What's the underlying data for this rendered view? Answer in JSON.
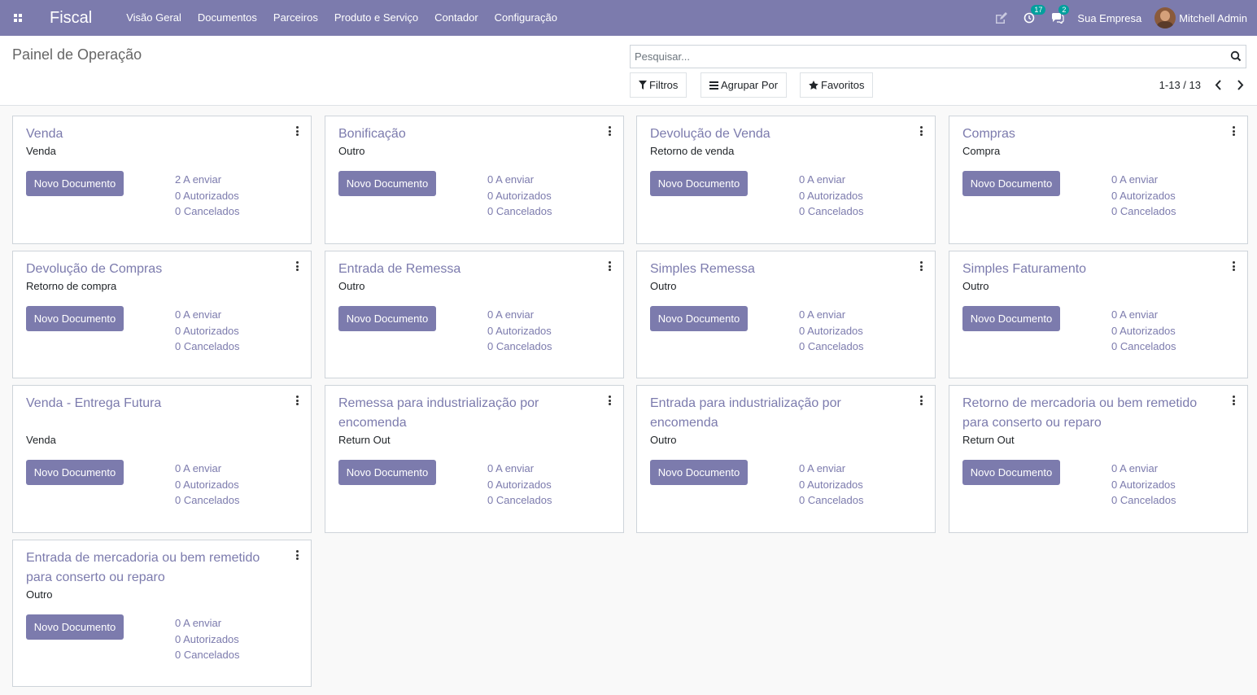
{
  "navbar": {
    "brand": "Fiscal",
    "menu": [
      "Visão Geral",
      "Documentos",
      "Parceiros",
      "Produto e Serviço",
      "Contador",
      "Configuração"
    ],
    "activity_count": "17",
    "messages_count": "2",
    "company": "Sua Empresa",
    "user": "Mitchell Admin"
  },
  "control_panel": {
    "title": "Painel de Operação",
    "search_placeholder": "Pesquisar...",
    "filters_label": "Filtros",
    "group_by_label": "Agrupar Por",
    "favorites_label": "Favoritos",
    "pager": "1-13 / 13"
  },
  "cards": [
    {
      "title": "Venda",
      "subtitle": "Venda",
      "button": "Novo Documento",
      "stats": [
        "2 A enviar",
        "0 Autorizados",
        "0 Cancelados"
      ]
    },
    {
      "title": "Bonificação",
      "subtitle": "Outro",
      "button": "Novo Documento",
      "stats": [
        "0 A enviar",
        "0 Autorizados",
        "0 Cancelados"
      ]
    },
    {
      "title": "Devolução de Venda",
      "subtitle": "Retorno de venda",
      "button": "Novo Documento",
      "stats": [
        "0 A enviar",
        "0 Autorizados",
        "0 Cancelados"
      ]
    },
    {
      "title": "Compras",
      "subtitle": "Compra",
      "button": "Novo Documento",
      "stats": [
        "0 A enviar",
        "0 Autorizados",
        "0 Cancelados"
      ]
    },
    {
      "title": "Devolução de Compras",
      "subtitle": "Retorno de compra",
      "button": "Novo Documento",
      "stats": [
        "0 A enviar",
        "0 Autorizados",
        "0 Cancelados"
      ]
    },
    {
      "title": "Entrada de Remessa",
      "subtitle": "Outro",
      "button": "Novo Documento",
      "stats": [
        "0 A enviar",
        "0 Autorizados",
        "0 Cancelados"
      ]
    },
    {
      "title": "Simples Remessa",
      "subtitle": "Outro",
      "button": "Novo Documento",
      "stats": [
        "0 A enviar",
        "0 Autorizados",
        "0 Cancelados"
      ]
    },
    {
      "title": "Simples Faturamento",
      "subtitle": "Outro",
      "button": "Novo Documento",
      "stats": [
        "0 A enviar",
        "0 Autorizados",
        "0 Cancelados"
      ]
    },
    {
      "title": "Venda - Entrega Futura",
      "subtitle": "Venda",
      "button": "Novo Documento",
      "stats": [
        "0 A enviar",
        "0 Autorizados",
        "0 Cancelados"
      ]
    },
    {
      "title": "Remessa para industrialização por encomenda",
      "subtitle": "Return Out",
      "button": "Novo Documento",
      "stats": [
        "0 A enviar",
        "0 Autorizados",
        "0 Cancelados"
      ]
    },
    {
      "title": "Entrada para industrialização por encomenda",
      "subtitle": "Outro",
      "button": "Novo Documento",
      "stats": [
        "0 A enviar",
        "0 Autorizados",
        "0 Cancelados"
      ]
    },
    {
      "title": "Retorno de mercadoria ou bem remetido para conserto ou reparo",
      "subtitle": "Return Out",
      "button": "Novo Documento",
      "stats": [
        "0 A enviar",
        "0 Autorizados",
        "0 Cancelados"
      ]
    },
    {
      "title": "Entrada de mercadoria ou bem remetido para conserto ou reparo",
      "subtitle": "Outro",
      "button": "Novo Documento",
      "stats": [
        "0 A enviar",
        "0 Autorizados",
        "0 Cancelados"
      ]
    }
  ],
  "colors": {
    "brand": "#7c7bad",
    "badge": "#00a09d"
  }
}
